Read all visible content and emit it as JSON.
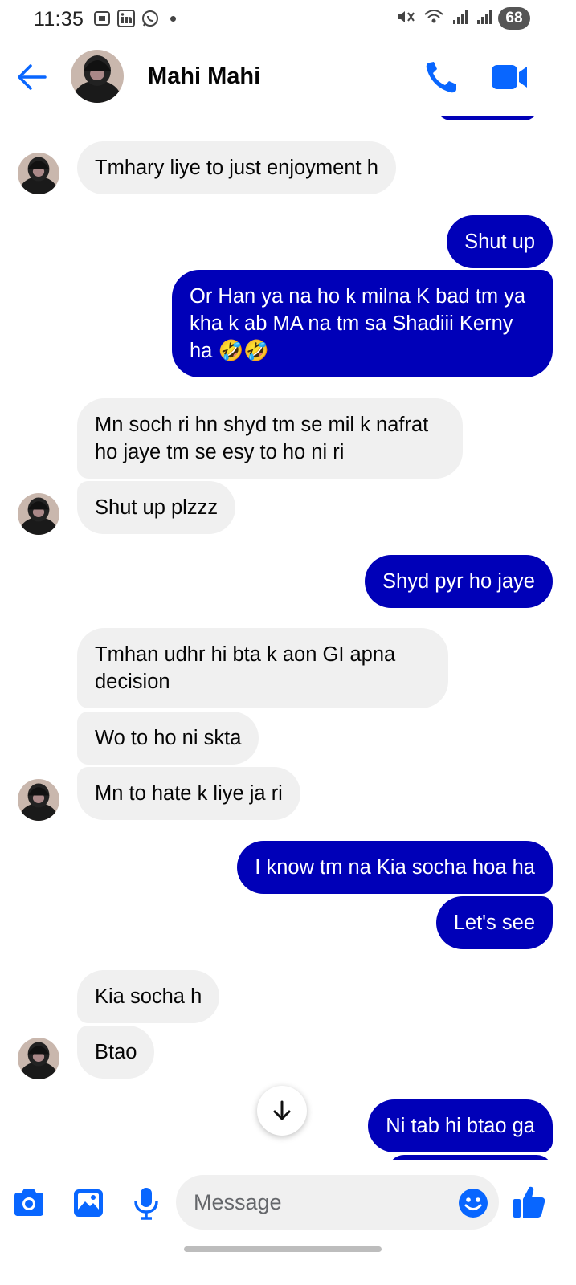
{
  "status_bar": {
    "time": "11:35",
    "battery": "68"
  },
  "header": {
    "contact_name": "Mahi Mahi"
  },
  "messages": [
    {
      "side": "in",
      "text": "Tmhary liye to just enjoyment h"
    },
    {
      "side": "out",
      "text": "Shut up"
    },
    {
      "side": "out",
      "text": "Or Han ya na ho k milna K bad tm ya kha k ab MA na tm sa Shadiii Kerny ha",
      "emoji": "🤣🤣"
    },
    {
      "side": "in",
      "text": "Mn soch ri hn shyd tm se mil k nafrat ho jaye tm se esy to ho ni ri"
    },
    {
      "side": "in",
      "text": "Shut up plzzz"
    },
    {
      "side": "out",
      "text": "Shyd pyr ho jaye"
    },
    {
      "side": "in",
      "text": "Tmhan udhr hi bta k aon GI apna decision"
    },
    {
      "side": "in",
      "text": "Wo to ho ni skta"
    },
    {
      "side": "in",
      "text": "Mn to hate k liye ja ri"
    },
    {
      "side": "out",
      "text": "I know tm na Kia socha hoa ha"
    },
    {
      "side": "out",
      "text": "Let's see"
    },
    {
      "side": "in",
      "text": "Kia socha h"
    },
    {
      "side": "in",
      "text": "Btao"
    },
    {
      "side": "out",
      "text": "Ni tab hi btao ga"
    }
  ],
  "composer": {
    "placeholder": "Message"
  },
  "icons": {
    "back": "back-arrow-icon",
    "call": "phone-icon",
    "video": "video-camera-icon",
    "camera": "camera-icon",
    "gallery": "image-icon",
    "mic": "microphone-icon",
    "emoji": "smiley-icon",
    "like": "thumbs-up-icon",
    "scroll": "arrow-down-icon"
  },
  "colors": {
    "accent": "#0866ff",
    "outgoing_bubble": "#0000b8",
    "incoming_bubble": "#f0f0f0"
  }
}
